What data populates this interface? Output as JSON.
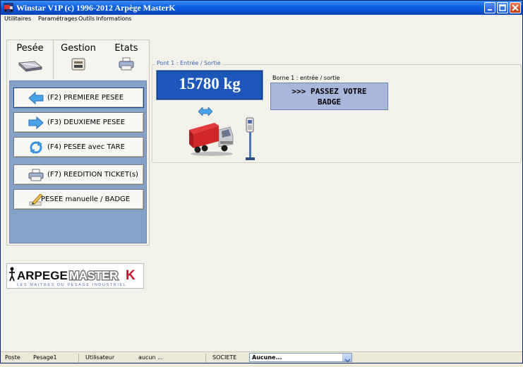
{
  "window": {
    "title": "Winstar V1P (c) 1996-2012 Arpège MasterK"
  },
  "menu": [
    "Utilitaires",
    "Paramétrages",
    "Outils",
    "Informations"
  ],
  "tabs": [
    {
      "label": "Pesée",
      "icon": "scale-icon"
    },
    {
      "label": "Gestion",
      "icon": "register-icon"
    },
    {
      "label": "Etats",
      "icon": "printer-icon"
    }
  ],
  "actions": [
    {
      "label": "(F2) PREMIERE PESEE",
      "icon": "arrow-left-icon",
      "active": true
    },
    {
      "label": "(F3) DEUXIEME PESEE",
      "icon": "arrow-right-icon"
    },
    {
      "label": "(F4) PESEE avec TARE",
      "icon": "refresh-icon"
    },
    {
      "label": "(F7) REEDITION TICKET(s)",
      "icon": "printer-icon"
    },
    {
      "label": "PESEE manuelle / BADGE",
      "icon": "pencil-icon"
    }
  ],
  "logo": {
    "brand": "ARPEGE",
    "brand2": "MASTER",
    "brand3": "K",
    "tagline": "LES MAITRES DU PESAGE INDUSTRIEL"
  },
  "bridge": {
    "title": "Pont 1 : Entrée / Sortie",
    "weight": "15780 kg",
    "borne_label": "Borne 1 : entrée / sortie",
    "display_line1": ">>> PASSEZ VOTRE",
    "display_line2": "BADGE"
  },
  "status": {
    "poste_label": "Poste",
    "poste_value": "Pesage1",
    "user_label": "Utilisateur",
    "user_value": "aucun ...",
    "societe_label": "SOCIETE",
    "societe_value": "Aucune..."
  },
  "colors": {
    "title_bar": "#0a5fe0",
    "weight_bg": "#1e57ba",
    "display_bg": "#a7b8da",
    "panel_bg": "#85a2c8",
    "logo_red": "#c8102e"
  }
}
